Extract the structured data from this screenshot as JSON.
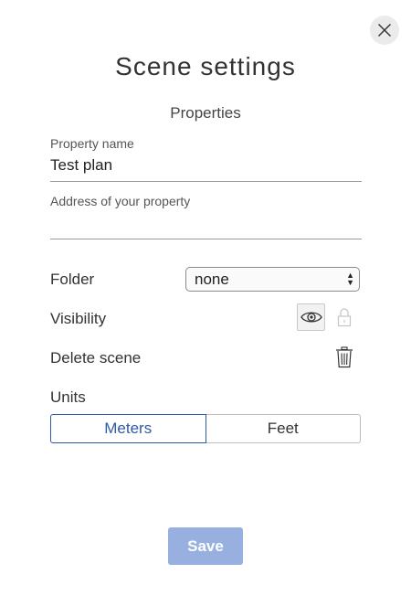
{
  "dialog": {
    "title": "Scene settings",
    "subtitle": "Properties",
    "close_icon": "close-icon"
  },
  "fields": {
    "property_name": {
      "label": "Property name",
      "value": "Test plan"
    },
    "address": {
      "label": "Address of your property",
      "value": ""
    }
  },
  "folder": {
    "label": "Folder",
    "selected": "none"
  },
  "visibility": {
    "label": "Visibility",
    "icons": [
      "eye-icon",
      "lock-icon"
    ]
  },
  "delete": {
    "label": "Delete scene",
    "icon": "trash-icon"
  },
  "units": {
    "label": "Units",
    "options": [
      "Meters",
      "Feet"
    ],
    "selected": "Meters"
  },
  "save": {
    "label": "Save"
  },
  "colors": {
    "accent": "#2f5aa8",
    "save_button_bg": "#97b0e0"
  }
}
